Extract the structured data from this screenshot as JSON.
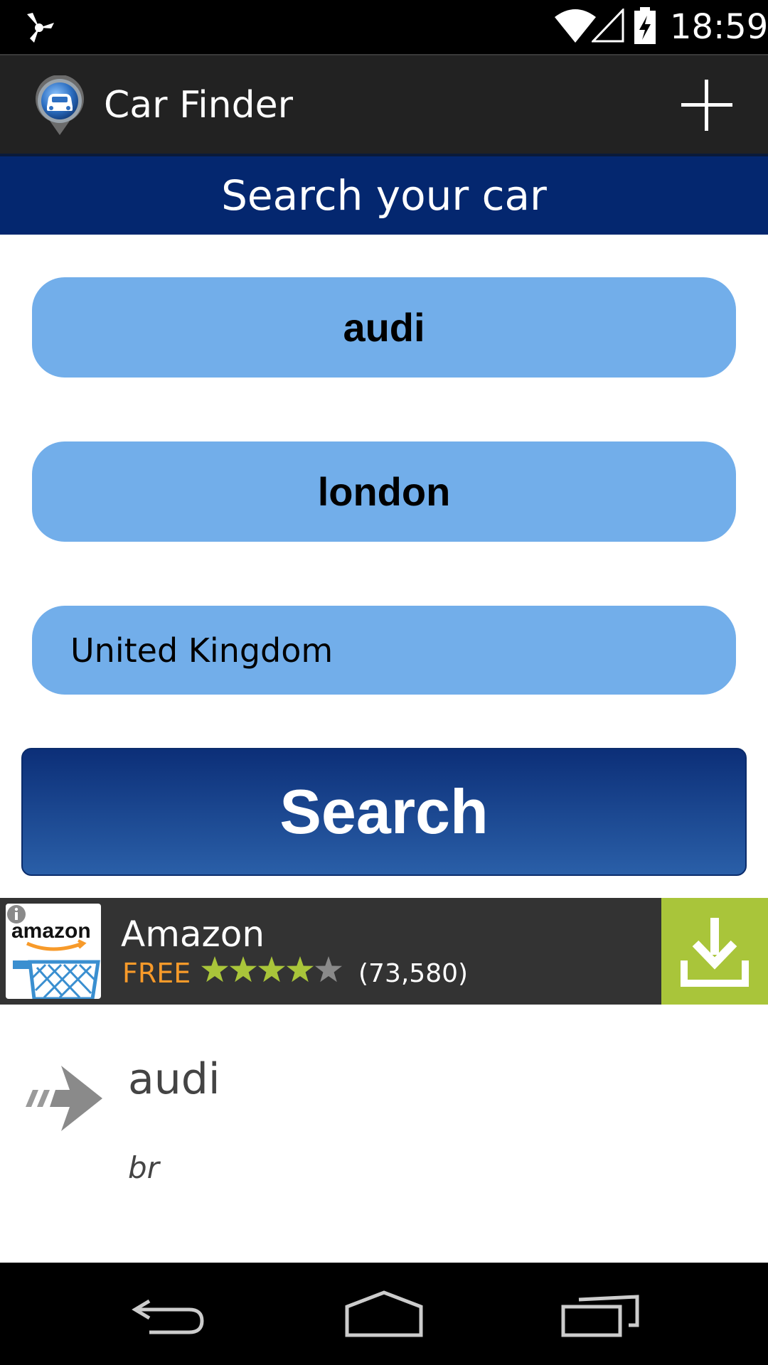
{
  "status_bar": {
    "time": "18:59",
    "icons": [
      "notification-icon",
      "wifi-icon",
      "signal-icon",
      "battery-charging-icon"
    ]
  },
  "app_bar": {
    "title": "Car Finder",
    "app_icon": "car-pin-icon",
    "action_icon": "plus-icon"
  },
  "header": {
    "title": "Search your car"
  },
  "form": {
    "make_value": "audi",
    "city_value": "london",
    "country_value": "United Kingdom",
    "search_label": "Search"
  },
  "ad": {
    "logo_text": "amazon",
    "name": "Amazon",
    "price": "FREE",
    "rating": 4,
    "rating_max": 5,
    "reviews": "(73,580)",
    "download_icon": "download-icon"
  },
  "result": {
    "title": "audi",
    "subtitle": "br",
    "icon": "arrow-right-icon"
  },
  "nav_bar": {
    "icons": [
      "back-icon",
      "home-icon",
      "recents-icon"
    ]
  },
  "colors": {
    "status_bar": "#000000",
    "app_bar": "#222222",
    "header_band": "#04276f",
    "pill": "#72aeea",
    "search_button_top": "#0c2f78",
    "search_button_bottom": "#2a5fa8",
    "ad_background": "#333333",
    "ad_price": "#f79a2a",
    "ad_download": "#a9c53a",
    "star_filled": "#a9c53a",
    "star_empty": "#8a8a8a"
  }
}
